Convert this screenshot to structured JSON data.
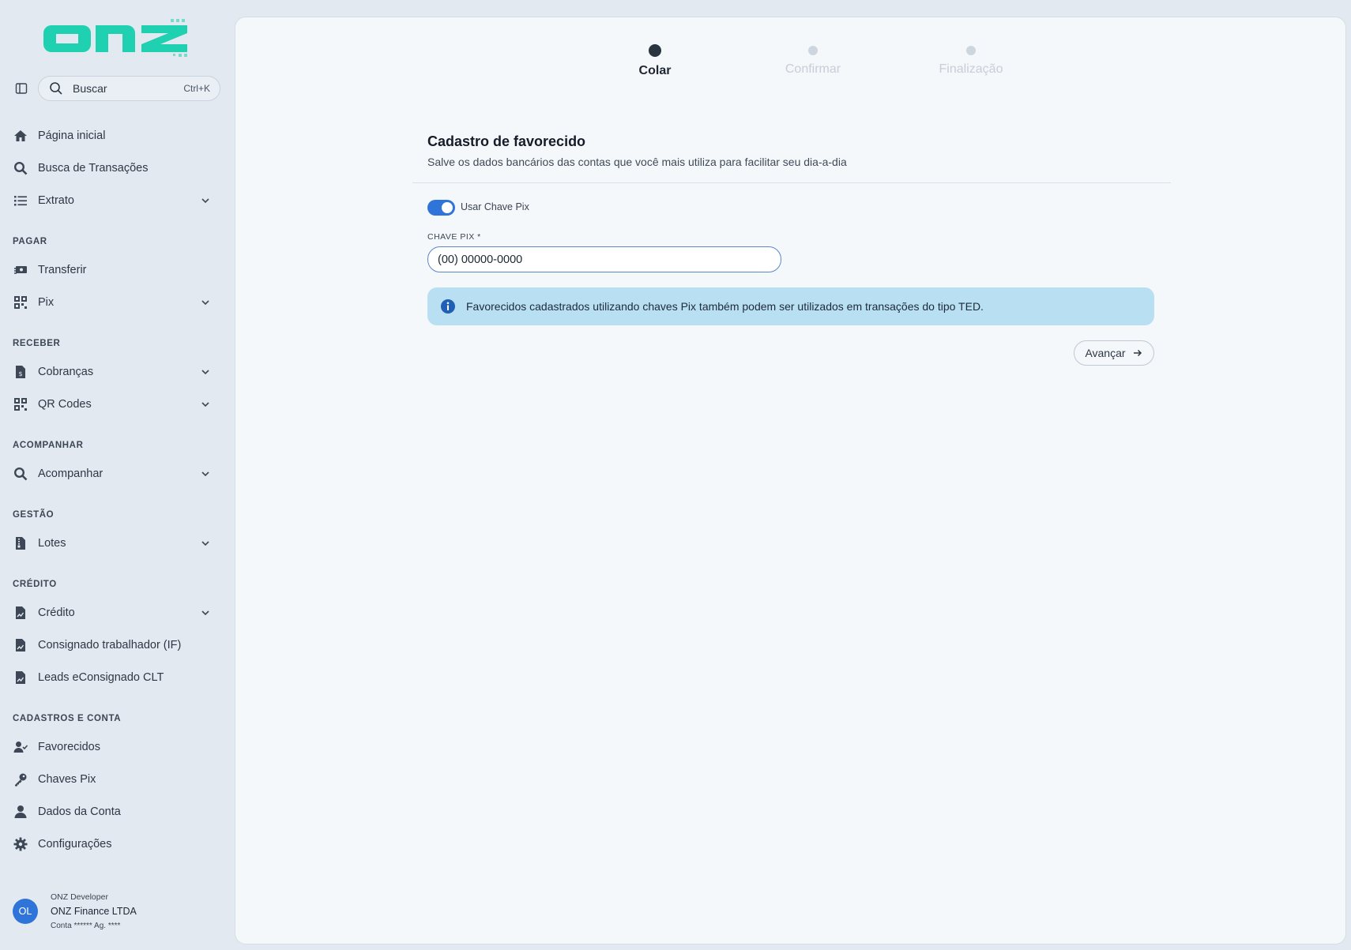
{
  "brand": {
    "logo_text": "onz",
    "accent": "#1fd1b0"
  },
  "sidebar": {
    "collapse_icon": "sidebar-toggle-icon",
    "search": {
      "label": "Buscar",
      "shortcut": "Ctrl+K",
      "icon": "search-icon"
    },
    "items": [
      {
        "label": "Página inicial",
        "icon": "home-icon",
        "expandable": false
      },
      {
        "label": "Busca de Transações",
        "icon": "search-icon",
        "expandable": false
      },
      {
        "label": "Extrato",
        "icon": "list-icon",
        "expandable": true
      },
      {
        "label": "Transferir",
        "icon": "money-transfer-icon",
        "expandable": false
      },
      {
        "label": "Pix",
        "icon": "qr-grid-icon",
        "expandable": true
      },
      {
        "label": "Cobranças",
        "icon": "invoice-dollar-icon",
        "expandable": true
      },
      {
        "label": "QR Codes",
        "icon": "qr-grid-icon",
        "expandable": true
      },
      {
        "label": "Acompanhar",
        "icon": "search-icon",
        "expandable": true
      },
      {
        "label": "Lotes",
        "icon": "file-zip-icon",
        "expandable": true
      },
      {
        "label": "Crédito",
        "icon": "file-chart-icon",
        "expandable": true
      },
      {
        "label": "Consignado trabalhador (IF)",
        "icon": "file-chart-icon",
        "expandable": false
      },
      {
        "label": "Leads eConsignado CLT",
        "icon": "file-chart-icon",
        "expandable": false
      },
      {
        "label": "Favorecidos",
        "icon": "user-check-icon",
        "expandable": false
      },
      {
        "label": "Chaves Pix",
        "icon": "key-icon",
        "expandable": false
      },
      {
        "label": "Dados da Conta",
        "icon": "user-icon",
        "expandable": false
      },
      {
        "label": "Configurações",
        "icon": "gear-icon",
        "expandable": false
      }
    ],
    "sections": [
      "PAGAR",
      "RECEBER",
      "ACOMPANHAR",
      "GESTÃO",
      "CRÉDITO",
      "CADASTROS E CONTA"
    ],
    "user": {
      "initials": "OL",
      "role": "ONZ Developer",
      "company": "ONZ Finance LTDA",
      "account": "Conta ****** Ag. ****"
    }
  },
  "stepper": {
    "steps": [
      {
        "label": "Colar",
        "active": true
      },
      {
        "label": "Confirmar",
        "active": false
      },
      {
        "label": "Finalização",
        "active": false
      }
    ]
  },
  "form": {
    "title": "Cadastro de favorecido",
    "subtitle": "Salve os dados bancários das contas que você mais utiliza para facilitar seu dia-a-dia",
    "toggle_label": "Usar Chave Pix",
    "toggle_on": true,
    "pix_label": "CHAVE PIX  *",
    "pix_value": "(00) 00000-0000",
    "info_text": "Favorecidos cadastrados utilizando chaves Pix também podem ser utilizados em transações do tipo TED.",
    "next_label": "Avançar"
  },
  "colors": {
    "primary": "#2f74d8",
    "info_bg": "#b9dff3",
    "text_dark": "#1f2a37"
  }
}
